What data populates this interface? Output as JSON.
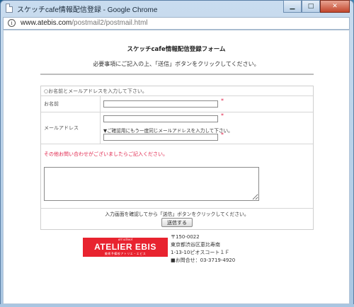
{
  "window": {
    "title": "スケッチcafe情報配信登録 - Google Chrome",
    "controls": {
      "minimize": "▁",
      "maximize": "□",
      "close": "✕"
    }
  },
  "addressbar": {
    "domain": "www.atebis.com",
    "path": "/postmail2/postmail.html",
    "icon": "info-icon"
  },
  "page": {
    "heading": "スケッチcafe情報配信登録フォーム",
    "lead": "必要事項にご記入の上、「送信」ボタンをクリックしてください。",
    "intro": "○お名前とメールアドレスを入力して下さい。",
    "name_label": "お名前",
    "email_label": "メールアドレス",
    "required_mark": "*",
    "email_confirm_note": "▼ご確認用にもう一度同じメールアドレスを入力して下さい。",
    "message_label": "その他お問い合わせがございましたらご記入ください。",
    "submit_note": "入力画面を確認してから「送信」ボタンをクリックしてください。",
    "submit_label": "送信する",
    "name_value": "",
    "email_value": "",
    "email_confirm_value": "",
    "message_value": ""
  },
  "footer": {
    "logo": {
      "top": "art school",
      "main": "ATELIER EBIS",
      "sub": "美術予備校アトリエ・エビス"
    },
    "address": [
      "〒150-0022",
      "東京都渋谷区恵比寿南",
      "1-13-10ピオスコート１Ｆ",
      "■お問合せ：03-3719-4920"
    ]
  },
  "colors": {
    "accent_red": "#e0234a",
    "logo_red": "#e8232f",
    "frame": "#a9c6e2"
  }
}
